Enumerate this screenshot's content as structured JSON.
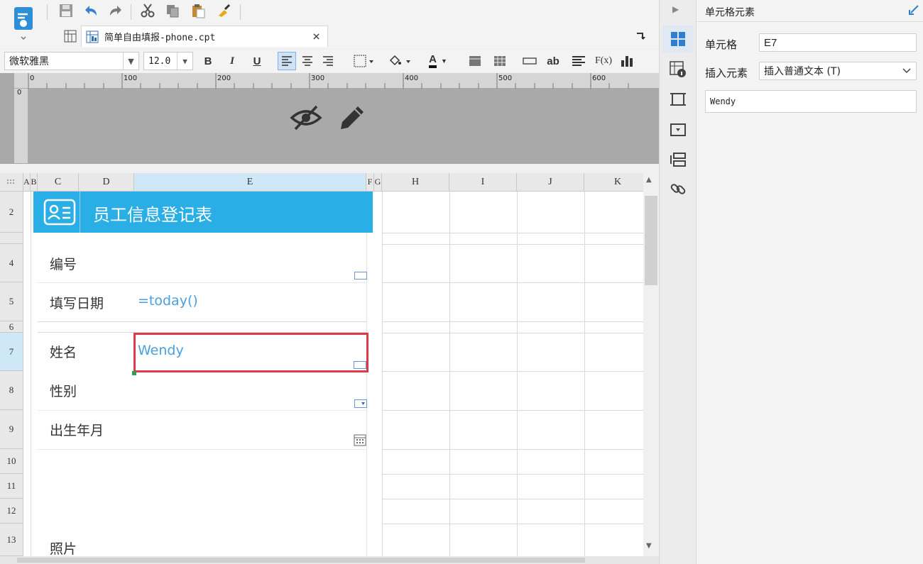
{
  "toolbar": {
    "app_icon": "report-designer-icon",
    "icons": [
      "save-icon",
      "undo-icon",
      "redo-icon",
      "cut-icon",
      "copy-icon",
      "paste-icon",
      "format-painter-icon"
    ]
  },
  "tab": {
    "title": "简单自由填报-phone.cpt",
    "close": "×"
  },
  "format": {
    "font": "微软雅黑",
    "size": "12.0",
    "bold": "B",
    "italic": "I",
    "underline": "U",
    "text_color_label": "A",
    "ab_label": "ab",
    "formula_label": "F(x)"
  },
  "ruler": {
    "ticks": [
      "0",
      "100",
      "200",
      "300",
      "400",
      "500",
      "600"
    ]
  },
  "columns": [
    "A",
    "B",
    "C",
    "D",
    "E",
    "F",
    "G",
    "H",
    "I",
    "J",
    "K"
  ],
  "rows": [
    "2",
    "4",
    "5",
    "6",
    "7",
    "8",
    "9",
    "10",
    "11",
    "12",
    "13"
  ],
  "form": {
    "title": "员工信息登记表",
    "id_label": "编号",
    "date_label": "填写日期",
    "date_value": "=today()",
    "name_label": "姓名",
    "name_value": "Wendy",
    "gender_label": "性别",
    "birth_label": "出生年月",
    "photo_label": "照片"
  },
  "panel": {
    "title": "单元格元素",
    "cell_label": "单元格",
    "cell_value": "E7",
    "insert_label": "插入元素",
    "insert_value": "插入普通文本 (T)",
    "content_value": "Wendy"
  },
  "colors": {
    "accent": "#29aee5",
    "highlight": "#e0394a",
    "value": "#4a9fe0"
  }
}
